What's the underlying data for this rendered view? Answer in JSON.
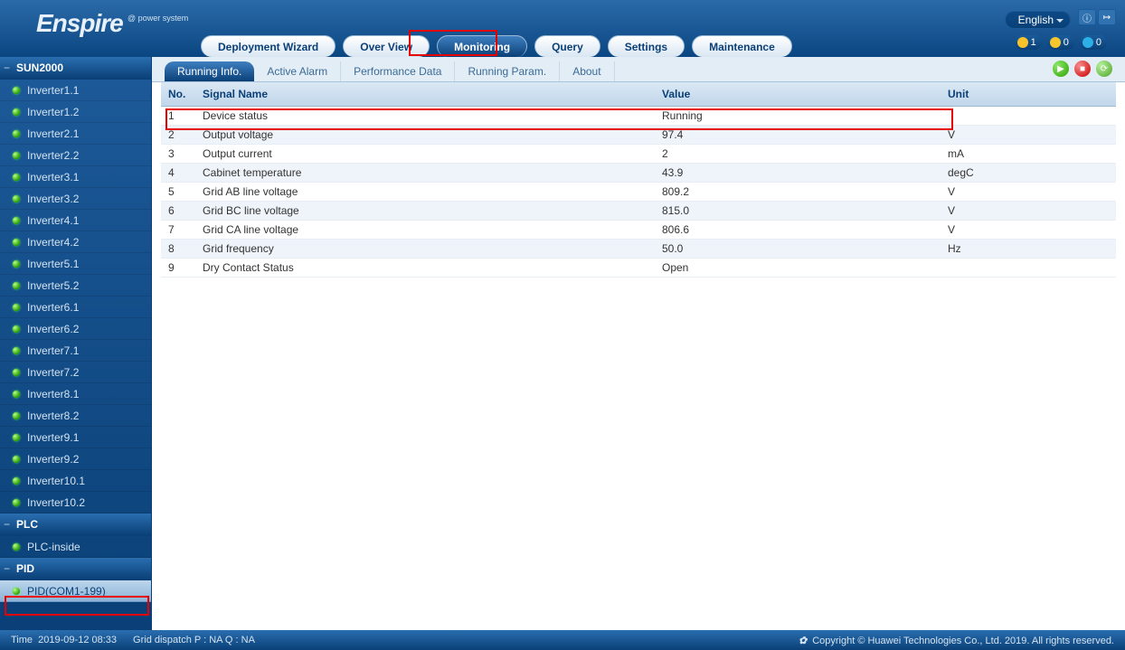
{
  "brand": {
    "main": "Enspire",
    "sub": "@ power system"
  },
  "language": "English",
  "nav": {
    "deployment": "Deployment Wizard",
    "overview": "Over View",
    "monitoring": "Monitoring",
    "query": "Query",
    "settings": "Settings",
    "maintenance": "Maintenance"
  },
  "badges": {
    "warn": "1",
    "exclaim": "0",
    "info": "0"
  },
  "sidebar": {
    "sun2000": "SUN2000",
    "inverters": [
      "Inverter1.1",
      "Inverter1.2",
      "Inverter2.1",
      "Inverter2.2",
      "Inverter3.1",
      "Inverter3.2",
      "Inverter4.1",
      "Inverter4.2",
      "Inverter5.1",
      "Inverter5.2",
      "Inverter6.1",
      "Inverter6.2",
      "Inverter7.1",
      "Inverter7.2",
      "Inverter8.1",
      "Inverter8.2",
      "Inverter9.1",
      "Inverter9.2",
      "Inverter10.1",
      "Inverter10.2"
    ],
    "plc_group": "PLC",
    "plc_inside": "PLC-inside",
    "pid_group": "PID",
    "pid_item": "PID(COM1-199)"
  },
  "subtabs": {
    "running_info": "Running Info.",
    "active_alarm": "Active Alarm",
    "performance_data": "Performance Data",
    "running_param": "Running Param.",
    "about": "About"
  },
  "table": {
    "headers": {
      "no": "No.",
      "name": "Signal Name",
      "value": "Value",
      "unit": "Unit"
    },
    "rows": [
      {
        "no": "1",
        "name": "Device status",
        "value": "Running",
        "unit": ""
      },
      {
        "no": "2",
        "name": "Output voltage",
        "value": "97.4",
        "unit": "V"
      },
      {
        "no": "3",
        "name": "Output current",
        "value": "2",
        "unit": "mA"
      },
      {
        "no": "4",
        "name": "Cabinet temperature",
        "value": "43.9",
        "unit": "degC"
      },
      {
        "no": "5",
        "name": "Grid AB line voltage",
        "value": "809.2",
        "unit": "V"
      },
      {
        "no": "6",
        "name": "Grid BC line voltage",
        "value": "815.0",
        "unit": "V"
      },
      {
        "no": "7",
        "name": "Grid CA line voltage",
        "value": "806.6",
        "unit": "V"
      },
      {
        "no": "8",
        "name": "Grid frequency",
        "value": "50.0",
        "unit": "Hz"
      },
      {
        "no": "9",
        "name": "Dry Contact Status",
        "value": "Open",
        "unit": ""
      }
    ]
  },
  "footer": {
    "time_label": "Time",
    "time_value": "2019-09-12 08:33",
    "dispatch": "Grid dispatch   P : NA   Q : NA",
    "copyright": "Copyright © Huawei Technologies Co., Ltd. 2019. All rights reserved.",
    "hw": "✿"
  }
}
